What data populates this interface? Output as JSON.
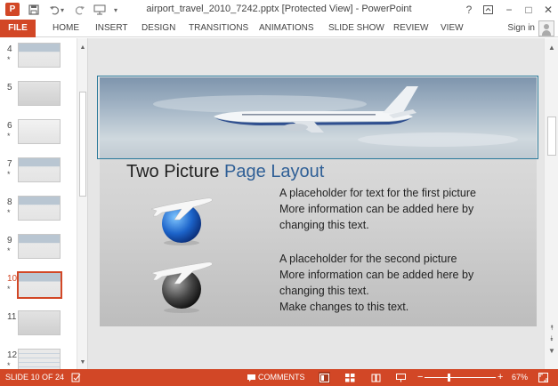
{
  "window": {
    "title": "airport_travel_2010_7242.pptx [Protected View] - PowerPoint",
    "help": "?",
    "minimize": "−",
    "restore": "□",
    "close": "✕"
  },
  "quick_access": {
    "save_icon": "save-icon",
    "undo_icon": "undo-icon",
    "redo_icon": "redo-icon",
    "customize": "▾"
  },
  "ribbon": {
    "tabs": [
      "FILE",
      "HOME",
      "INSERT",
      "DESIGN",
      "TRANSITIONS",
      "ANIMATIONS",
      "SLIDE SHOW",
      "REVIEW",
      "VIEW"
    ],
    "sign_in": "Sign in"
  },
  "thumbnails": [
    {
      "num": "4",
      "star": "*"
    },
    {
      "num": "5",
      "star": ""
    },
    {
      "num": "6",
      "star": "*"
    },
    {
      "num": "7",
      "star": "*"
    },
    {
      "num": "8",
      "star": "*"
    },
    {
      "num": "9",
      "star": "*"
    },
    {
      "num": "10",
      "star": "*",
      "active": true
    },
    {
      "num": "11",
      "star": ""
    },
    {
      "num": "12",
      "star": "*"
    }
  ],
  "slide": {
    "title_part1": "Two Picture",
    "title_part2": "Page Layout",
    "block1": [
      "A placeholder for text for the first picture",
      "More information can be added here by",
      "changing this text."
    ],
    "block2": [
      "A placeholder for the second picture",
      "More information can be added here by",
      "changing this text.",
      "Make changes to this text."
    ]
  },
  "statusbar": {
    "slide_info": "SLIDE 10 OF 24",
    "comments": "COMMENTS",
    "zoom_minus": "−",
    "zoom_plus": "+",
    "zoom_level": "67%",
    "zoom_fraction": 0.67
  },
  "colors": {
    "accent": "#d24726",
    "title_accent": "#2f5f96",
    "selection": "#2b7a9b"
  }
}
